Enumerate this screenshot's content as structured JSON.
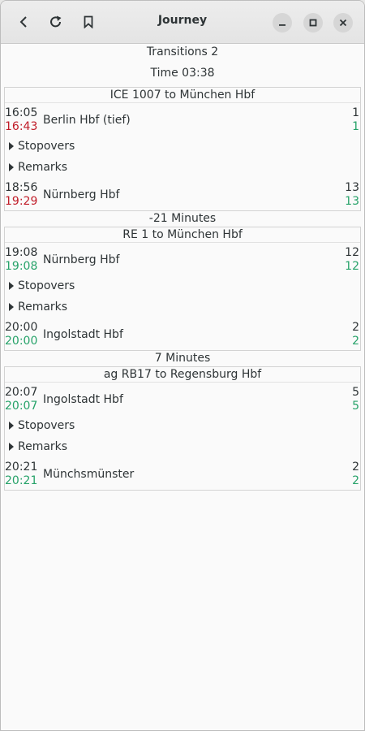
{
  "header": {
    "title": "Journey",
    "icons": [
      "back-icon",
      "refresh-icon",
      "bookmark-icon",
      "minimize-icon",
      "maximize-icon",
      "close-icon"
    ]
  },
  "summary": {
    "transitions": "Transitions 2",
    "time": "Time 03:38"
  },
  "expanders": {
    "stopovers": "Stopovers",
    "remarks": "Remarks"
  },
  "legs": [
    {
      "title": "ICE 1007 to München Hbf",
      "dep": {
        "planned": "16:05",
        "actual": "16:43",
        "station": "Berlin Hbf (tief)",
        "platform_planned": "1",
        "platform_actual": "1"
      },
      "arr": {
        "planned": "18:56",
        "actual": "19:29",
        "station": "Nürnberg Hbf",
        "platform_planned": "13",
        "platform_actual": "13"
      }
    },
    {
      "title": "RE 1 to München Hbf",
      "dep": {
        "planned": "19:08",
        "actual": "19:08",
        "station": "Nürnberg Hbf",
        "platform_planned": "12",
        "platform_actual": "12"
      },
      "arr": {
        "planned": "20:00",
        "actual": "20:00",
        "station": "Ingolstadt Hbf",
        "platform_planned": "2",
        "platform_actual": "2"
      }
    },
    {
      "title": "ag RB17 to Regensburg Hbf",
      "dep": {
        "planned": "20:07",
        "actual": "20:07",
        "station": "Ingolstadt Hbf",
        "platform_planned": "5",
        "platform_actual": "5"
      },
      "arr": {
        "planned": "20:21",
        "actual": "20:21",
        "station": "Münchsmünster",
        "platform_planned": "2",
        "platform_actual": "2"
      }
    }
  ],
  "transfers": [
    "-21 Minutes",
    "7 Minutes"
  ],
  "colors": {
    "delay": "#c01c28",
    "ontime": "#26a269",
    "text": "#2e3436"
  }
}
